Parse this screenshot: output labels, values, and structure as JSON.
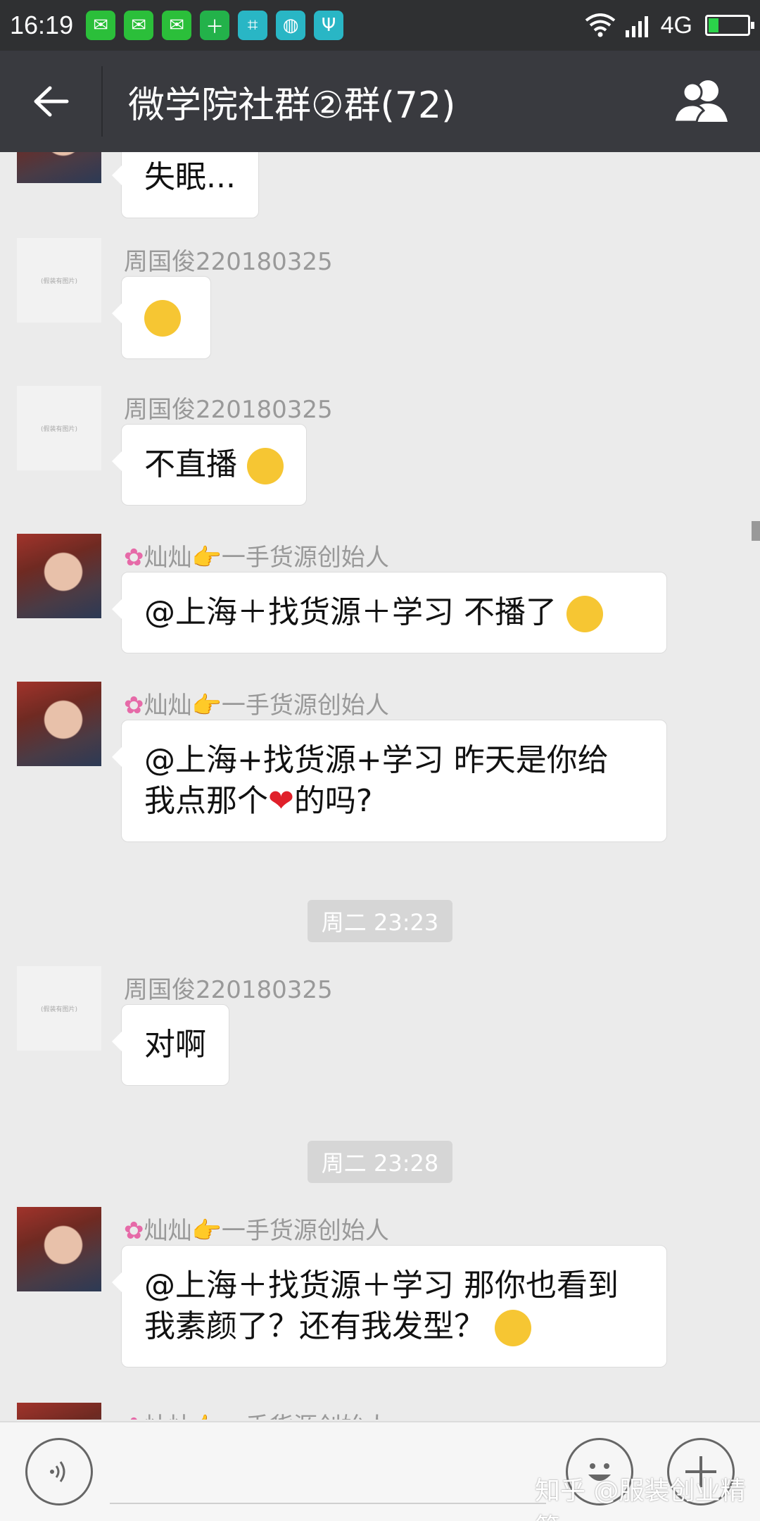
{
  "status_bar": {
    "time": "16:19",
    "notifications": [
      "wechat-icon",
      "wechat-icon",
      "wechat-icon",
      "add-icon",
      "scan-icon",
      "basketball-icon",
      "usb-icon"
    ],
    "network": "4G",
    "battery_level": 0.25
  },
  "header": {
    "title": "微学院社群②群(72)"
  },
  "messages": [
    {
      "type": "text",
      "text": "失眠..."
    },
    {
      "type": "sender",
      "name": "周国俊220180325"
    },
    {
      "type": "sender",
      "name": "周国俊220180325",
      "text": "不直播"
    },
    {
      "type": "sender",
      "name": "灿灿👉一手货源创始人",
      "text": "@上海＋找货源＋学习  不播了"
    },
    {
      "type": "sender",
      "name": "灿灿👉一手货源创始人",
      "text_line1": "@上海+找货源+学习 昨天是你给",
      "text_line2_a": "我点那个",
      "text_line2_b": "的吗?"
    },
    {
      "type": "time",
      "text": "周二 23:23"
    },
    {
      "type": "sender",
      "name": "周国俊220180325",
      "text": "对啊"
    },
    {
      "type": "time",
      "text": "周二 23:28"
    },
    {
      "type": "sender",
      "name": "灿灿👉一手货源创始人",
      "text_line1": "@上海＋找货源＋学习  那你也看到",
      "text_line2": "我素颜了？还有我发型？"
    },
    {
      "type": "sender",
      "name": "灿灿👉一手货源创始人"
    }
  ],
  "placeholder_avatar_text": "(假装有图片)",
  "watermark": "知乎 @服装创业精简"
}
